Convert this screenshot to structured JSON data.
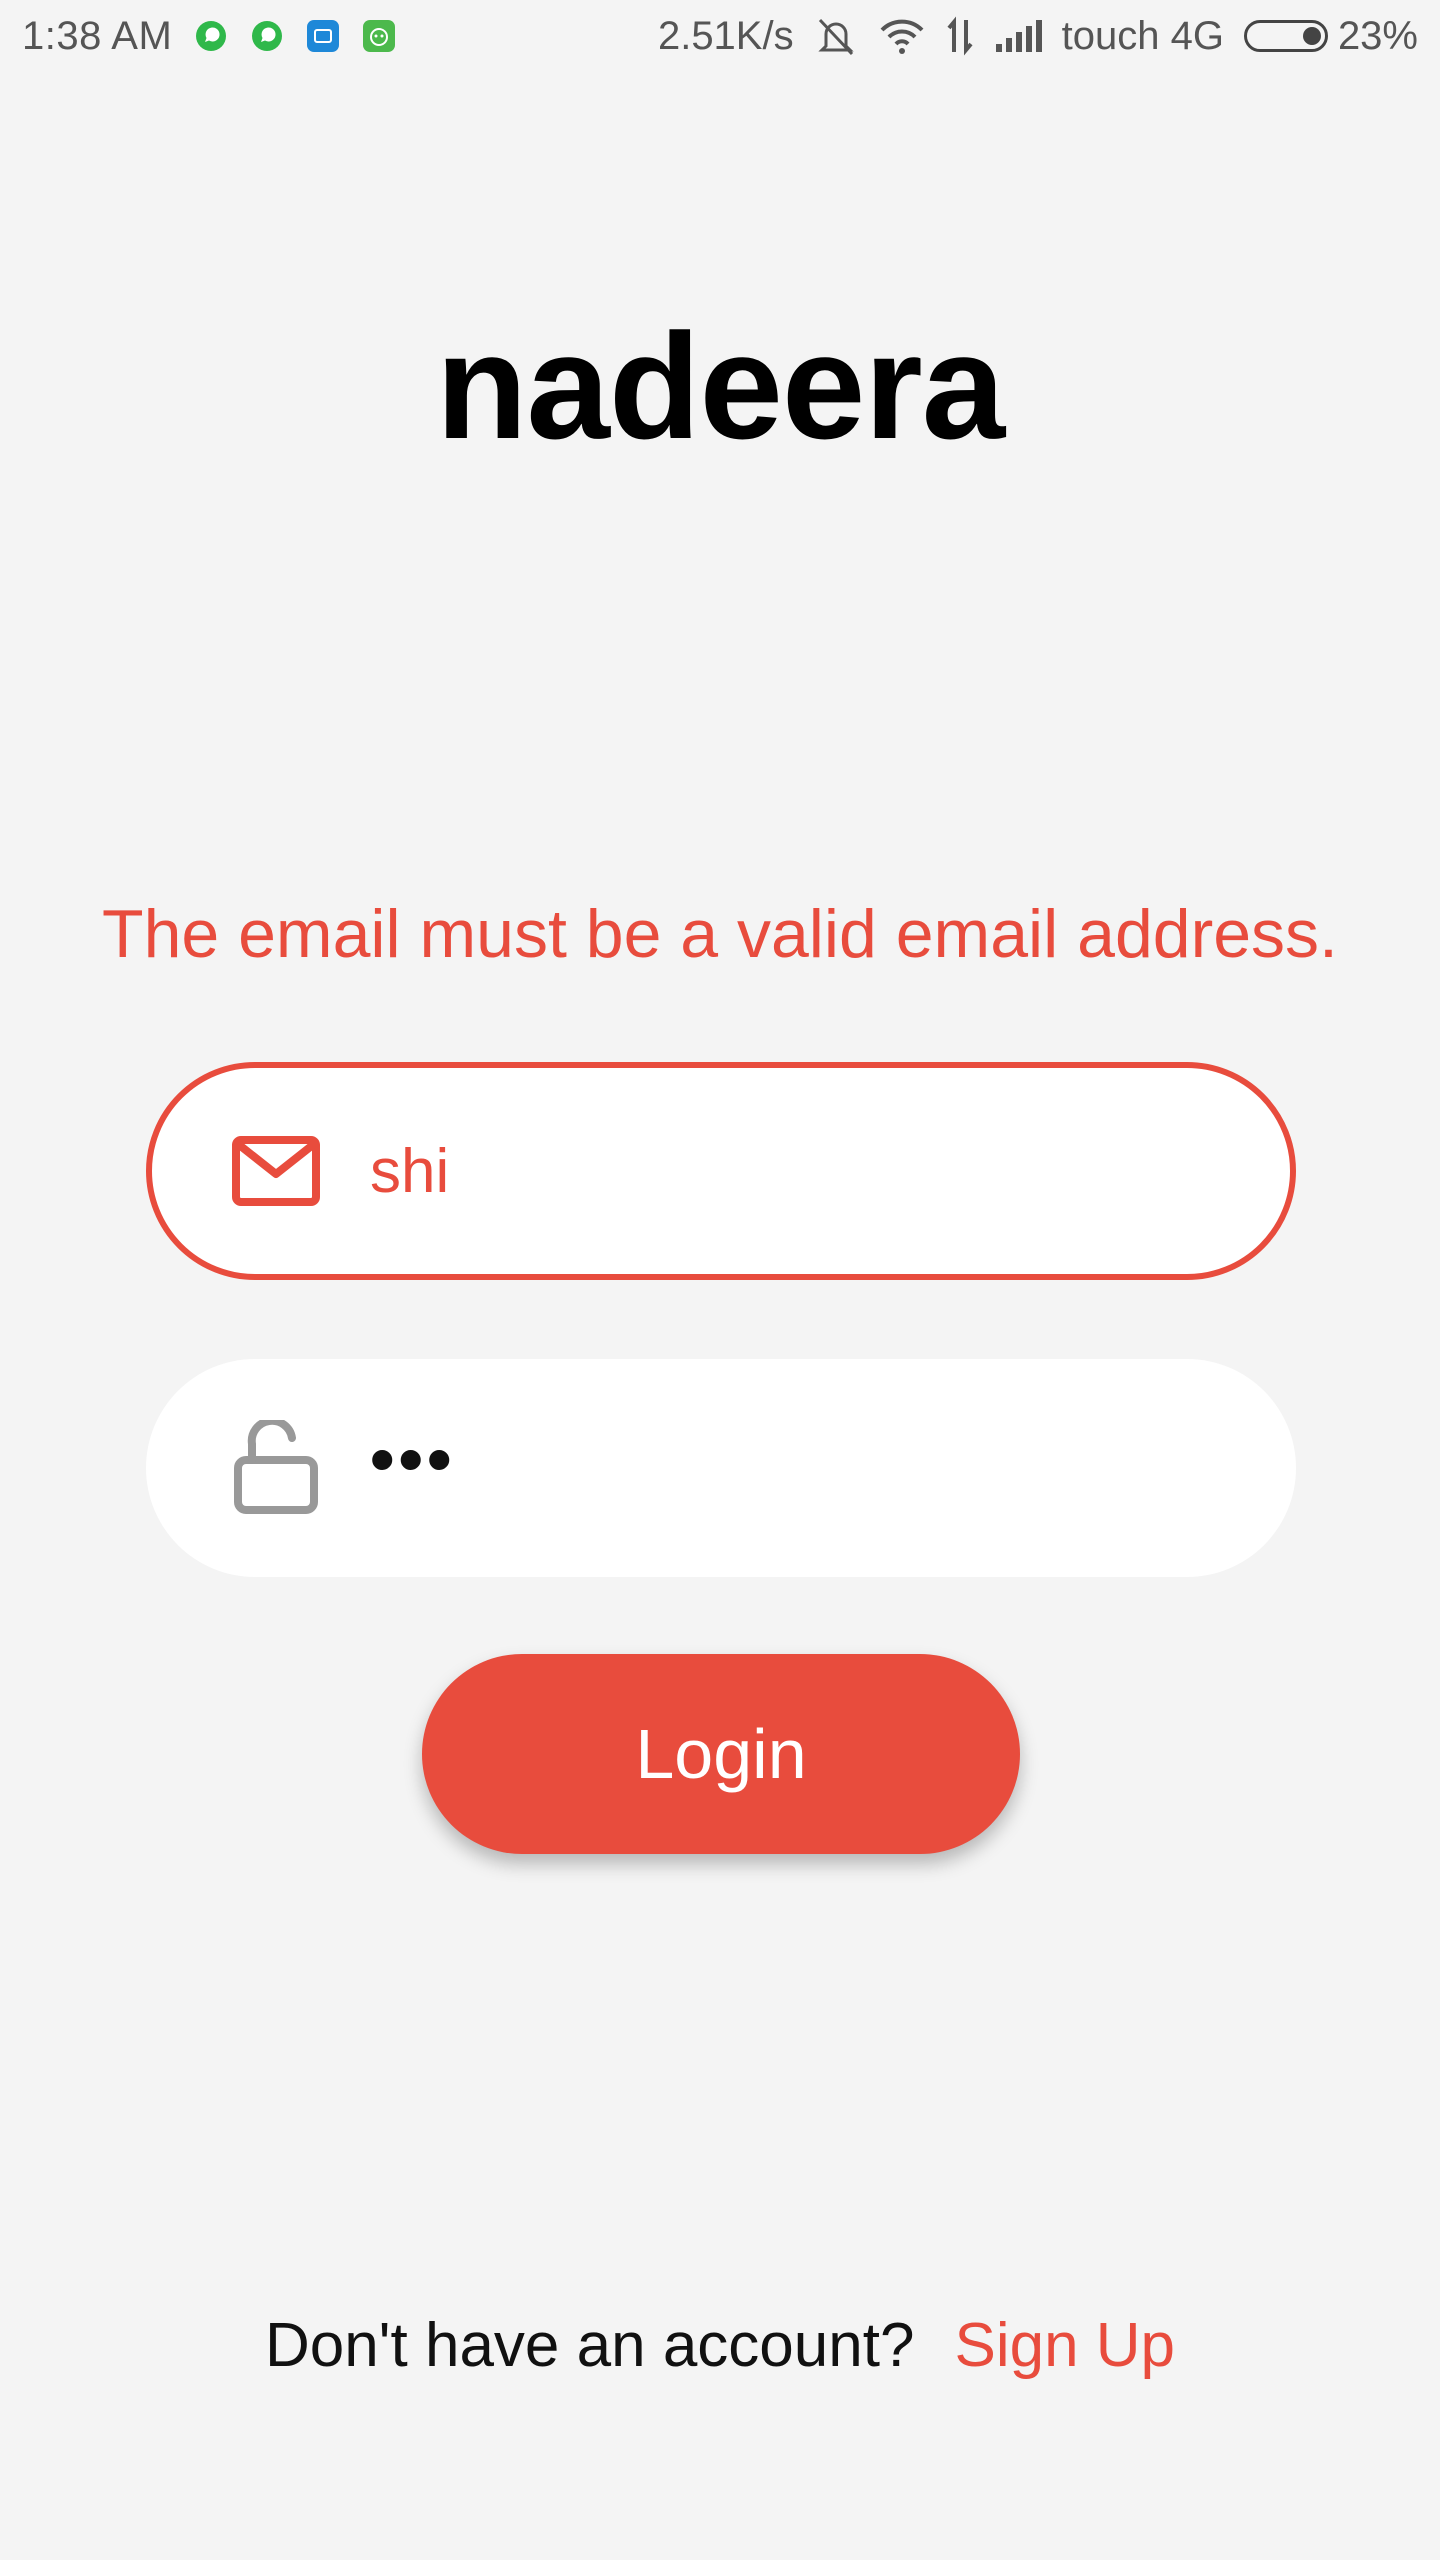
{
  "status_bar": {
    "time": "1:38  AM",
    "network_speed": "2.51K/s",
    "carrier": "touch 4G",
    "battery_percent": "23%",
    "battery_level": 0.23,
    "notification_icons": [
      "whatsapp-icon",
      "whatsapp-icon",
      "app-icon",
      "android-app-icon"
    ]
  },
  "app": {
    "title": "nadeera"
  },
  "form": {
    "error_message": "The email must be a valid email address.",
    "email": {
      "value": "shi",
      "icon": "mail-icon"
    },
    "password": {
      "masked_value": "•••",
      "icon": "unlock-icon"
    },
    "login_label": "Login"
  },
  "footer": {
    "prompt": "Don't have an account?",
    "signup_label": "Sign Up"
  },
  "colors": {
    "accent": "#e84c3d",
    "background": "#f4f4f4",
    "field_background": "#ffffff"
  }
}
